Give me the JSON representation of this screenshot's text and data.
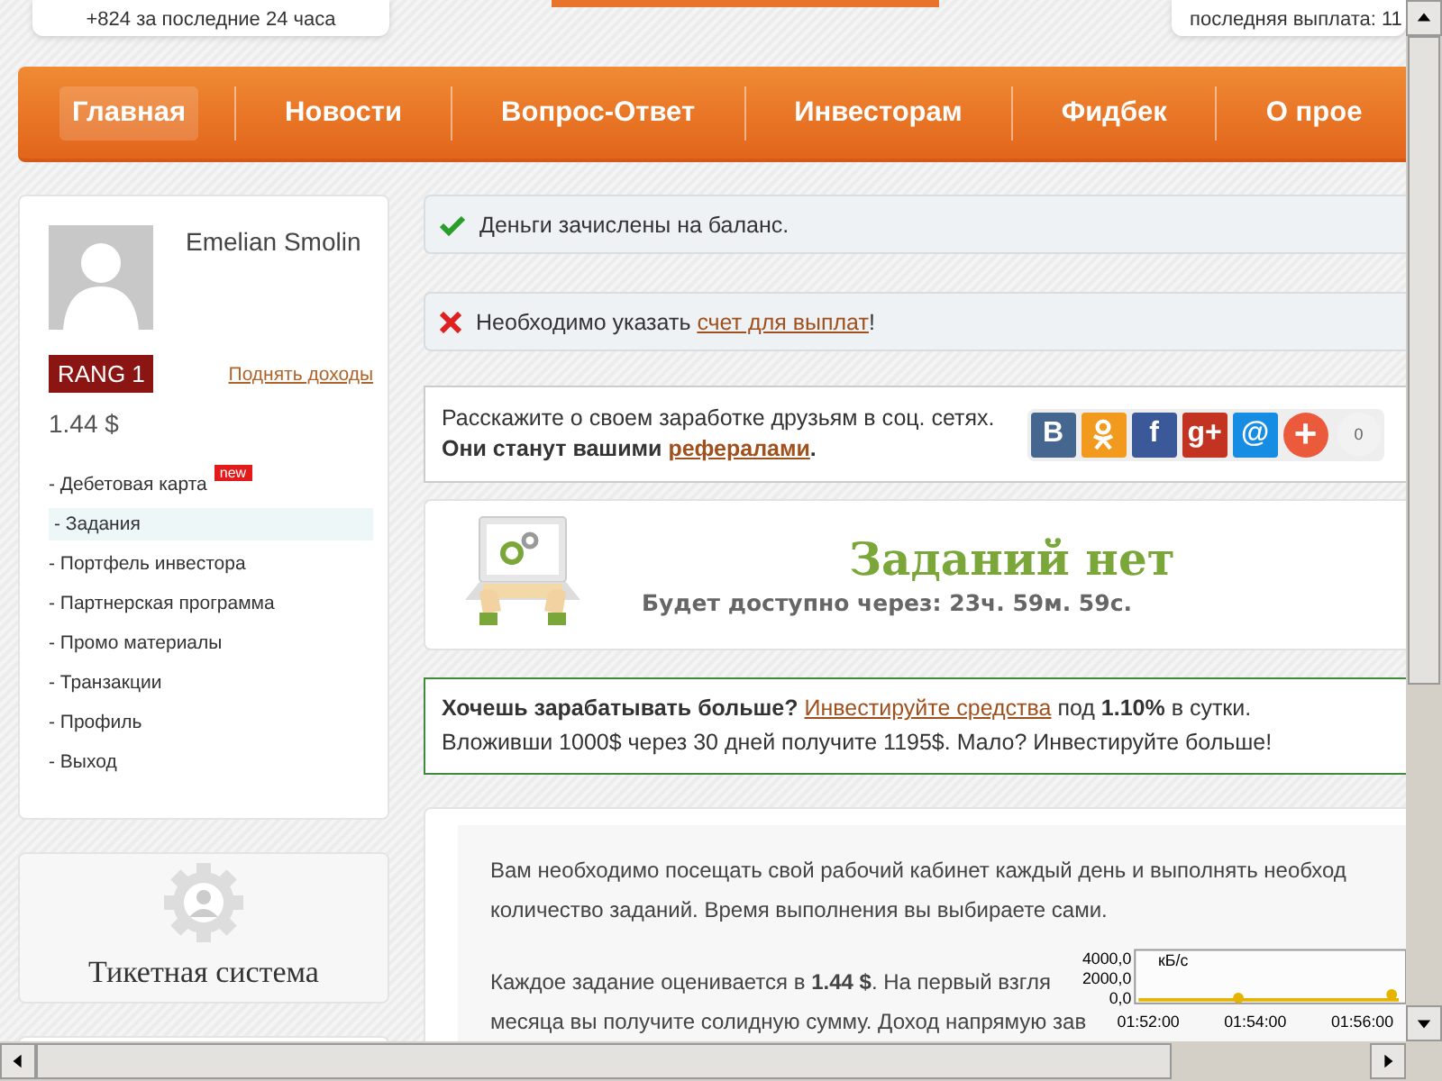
{
  "header_stats": [
    {
      "text": "+824 за последние 24 часа"
    },
    {
      "text": "последняя выплата: 11"
    }
  ],
  "nav": [
    {
      "label": "Главная",
      "selected": true
    },
    {
      "label": "Новости",
      "selected": false
    },
    {
      "label": "Вопрос-Ответ",
      "selected": false
    },
    {
      "label": "Инвесторам",
      "selected": false
    },
    {
      "label": "Фидбек",
      "selected": false
    },
    {
      "label": "О прое",
      "selected": false
    }
  ],
  "sidebar": {
    "user_name": "Emelian Smolin",
    "rank": "RANG 1",
    "raise_link": "Поднять доходы",
    "balance": "1.44 $",
    "menu": [
      {
        "label": "- Дебетовая карта",
        "selected": false,
        "badge": "new"
      },
      {
        "label": "- Задания",
        "selected": true
      },
      {
        "label": "- Портфель инвестора",
        "selected": false
      },
      {
        "label": "- Партнерская программа",
        "selected": false
      },
      {
        "label": "- Промо материалы",
        "selected": false
      },
      {
        "label": "- Транзакции",
        "selected": false
      },
      {
        "label": "- Профиль",
        "selected": false
      },
      {
        "label": "- Выход",
        "selected": false
      }
    ]
  },
  "ticket_card": {
    "title": "Тикетная система"
  },
  "alerts": [
    {
      "kind": "success",
      "text": "Деньги зачислены на баланс."
    },
    {
      "kind": "error",
      "text": "Необходимо указать ",
      "link": "счет для выплат",
      "after": "!"
    }
  ],
  "share": {
    "line1": "Расскажите о своем заработке друзьям в соц. сетях.",
    "line2": "Они станут вашими ",
    "link": "рефералами",
    "after": ".",
    "buttons": [
      {
        "kind": "vk",
        "label": "В"
      },
      {
        "kind": "ok"
      },
      {
        "kind": "fb",
        "label": "f"
      },
      {
        "kind": "gplus",
        "label": "g+"
      },
      {
        "kind": "mail",
        "label": "@"
      },
      {
        "kind": "more",
        "label": "+"
      }
    ],
    "counter": "0"
  },
  "tasks": {
    "title": "Заданий нет",
    "countdown": "Будет доступно через: 23ч. 59м. 59с."
  },
  "invest": {
    "question": "Хочешь зарабатывать больше?",
    "link": "Инвестируйте средства",
    "rest": " под **1.10%** в сутки.",
    "line2": "Вложивши 1000$ через 30 дней получите 1195$. Мало? Инвестируйте больше!"
  },
  "info": {
    "paragraphs": [
      [
        "Вам необходимо посещать свой рабочий кабинет каждый день и выполнять необход",
        "количество заданий. Время выполнения вы выбираете сами."
      ],
      [
        "Каждое задание оценивается в **1.44 $**. На первый взгля",
        "месяца вы получите солидную сумму. Доход напрямую зав"
      ]
    ]
  },
  "mini_chart": {
    "y_labels": [
      "4000,0",
      "2000,0",
      "0,0"
    ],
    "x_labels": [
      "01:52:00",
      "01:54:00",
      "01:56:00"
    ],
    "legend": "кБ/с"
  }
}
